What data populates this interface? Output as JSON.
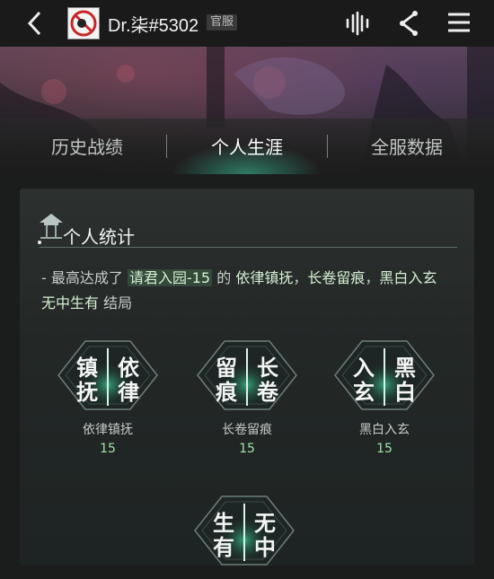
{
  "header": {
    "username": "Dr.柒#5302",
    "badge": "官服",
    "icons": [
      "back-arrow-icon",
      "avatar",
      "audio-wave-icon",
      "share-icon",
      "menu-icon"
    ]
  },
  "tabs": [
    {
      "label": "历史战绩",
      "active": false
    },
    {
      "label": "个人生涯",
      "active": true
    },
    {
      "label": "全服数据",
      "active": false
    }
  ],
  "stats": {
    "title": "个人统计",
    "desc_prefix": "- 最高达成了",
    "stage": "请君入园-15",
    "desc_of": "的",
    "ending_a": "依律镇抚",
    "sep1": "，",
    "ending_b": "长卷留痕",
    "sep2": "，",
    "ending_c": "黑白入玄",
    "sep3": "，",
    "ending_d": "无中生有",
    "desc_suffix": "结局"
  },
  "endings": [
    {
      "name": "依律镇抚",
      "count": "15",
      "glyphs": [
        "镇",
        "依",
        "抚",
        "律"
      ]
    },
    {
      "name": "长卷留痕",
      "count": "15",
      "glyphs": [
        "留",
        "长",
        "痕",
        "卷"
      ]
    },
    {
      "name": "黑白入玄",
      "count": "15",
      "glyphs": [
        "入",
        "黑",
        "玄",
        "白"
      ]
    },
    {
      "name": "",
      "count": "",
      "glyphs": [
        "生",
        "无",
        "有",
        "中"
      ]
    }
  ],
  "colors": {
    "accent": "#3fcf9a",
    "highlight": "#d6f0d3",
    "count": "#9fe4a8"
  }
}
